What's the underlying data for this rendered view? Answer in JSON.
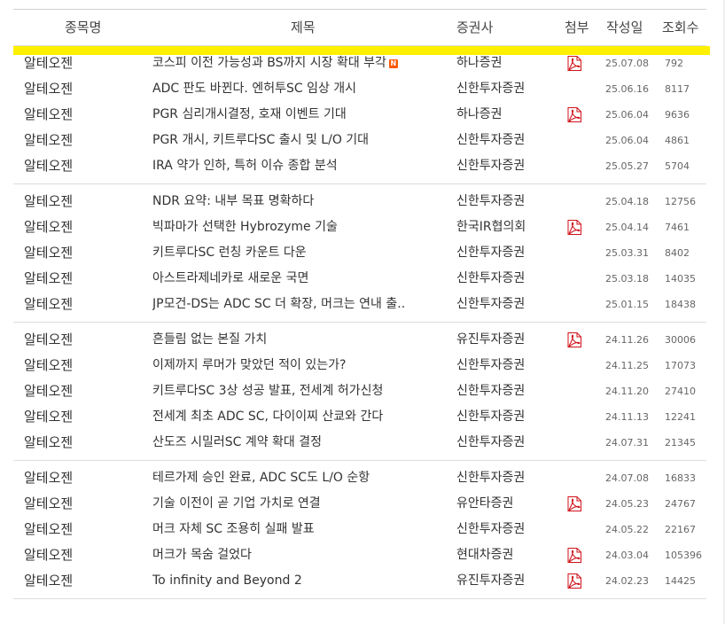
{
  "table": {
    "headers": {
      "stock": "종목명",
      "title": "제목",
      "broker": "증권사",
      "attach": "첨부",
      "date": "작성일",
      "views": "조회수"
    },
    "new_badge": "N",
    "groups": [
      [
        {
          "stock": "알테오젠",
          "title": "코스피 이전 가능성과 BS까지 시장 확대 부각",
          "is_new": true,
          "broker": "하나증권",
          "has_pdf": true,
          "date": "25.07.08",
          "views": "792"
        },
        {
          "stock": "알테오젠",
          "title": "ADC 판도 바뀐다. 엔허투SC 임상 개시",
          "is_new": false,
          "broker": "신한투자증권",
          "has_pdf": false,
          "date": "25.06.16",
          "views": "8117"
        },
        {
          "stock": "알테오젠",
          "title": "PGR 심리개시결정, 호재 이벤트 기대",
          "is_new": false,
          "broker": "하나증권",
          "has_pdf": true,
          "date": "25.06.04",
          "views": "9636"
        },
        {
          "stock": "알테오젠",
          "title": "PGR 개시, 키트루다SC 출시 및 L/O 기대",
          "is_new": false,
          "broker": "신한투자증권",
          "has_pdf": false,
          "date": "25.06.04",
          "views": "4861"
        },
        {
          "stock": "알테오젠",
          "title": "IRA 약가 인하, 특허 이슈 종합 분석",
          "is_new": false,
          "broker": "신한투자증권",
          "has_pdf": false,
          "date": "25.05.27",
          "views": "5704"
        }
      ],
      [
        {
          "stock": "알테오젠",
          "title": "NDR 요약: 내부 목표 명확하다",
          "is_new": false,
          "broker": "신한투자증권",
          "has_pdf": false,
          "date": "25.04.18",
          "views": "12756"
        },
        {
          "stock": "알테오젠",
          "title": "빅파마가 선택한 Hybrozyme 기술",
          "is_new": false,
          "broker": "한국IR협의회",
          "has_pdf": true,
          "date": "25.04.14",
          "views": "7461"
        },
        {
          "stock": "알테오젠",
          "title": "키트루다SC 런칭 카운트 다운",
          "is_new": false,
          "broker": "신한투자증권",
          "has_pdf": false,
          "date": "25.03.31",
          "views": "8402"
        },
        {
          "stock": "알테오젠",
          "title": "아스트라제네카로 새로운 국면",
          "is_new": false,
          "broker": "신한투자증권",
          "has_pdf": false,
          "date": "25.03.18",
          "views": "14035"
        },
        {
          "stock": "알테오젠",
          "title": "JP모건-DS는 ADC SC 더 확장, 머크는 연내 출..",
          "is_new": false,
          "broker": "신한투자증권",
          "has_pdf": false,
          "date": "25.01.15",
          "views": "18438"
        }
      ],
      [
        {
          "stock": "알테오젠",
          "title": "흔들림 없는 본질 가치",
          "is_new": false,
          "broker": "유진투자증권",
          "has_pdf": true,
          "date": "24.11.26",
          "views": "30006"
        },
        {
          "stock": "알테오젠",
          "title": "이제까지 루머가 맞았던 적이 있는가?",
          "is_new": false,
          "broker": "신한투자증권",
          "has_pdf": false,
          "date": "24.11.25",
          "views": "17073"
        },
        {
          "stock": "알테오젠",
          "title": "키트루다SC 3상 성공 발표, 전세계 허가신청",
          "is_new": false,
          "broker": "신한투자증권",
          "has_pdf": false,
          "date": "24.11.20",
          "views": "27410"
        },
        {
          "stock": "알테오젠",
          "title": "전세계 최초 ADC SC, 다이이찌 산쿄와 간다",
          "is_new": false,
          "broker": "신한투자증권",
          "has_pdf": false,
          "date": "24.11.13",
          "views": "12241"
        },
        {
          "stock": "알테오젠",
          "title": "산도즈 시밀러SC 계약 확대 결정",
          "is_new": false,
          "broker": "신한투자증권",
          "has_pdf": false,
          "date": "24.07.31",
          "views": "21345"
        }
      ],
      [
        {
          "stock": "알테오젠",
          "title": "테르가제 승인 완료, ADC SC도 L/O 순항",
          "is_new": false,
          "broker": "신한투자증권",
          "has_pdf": false,
          "date": "24.07.08",
          "views": "16833"
        },
        {
          "stock": "알테오젠",
          "title": "기술 이전이 곧 기업 가치로 연결",
          "is_new": false,
          "broker": "유안타증권",
          "has_pdf": true,
          "date": "24.05.23",
          "views": "24767"
        },
        {
          "stock": "알테오젠",
          "title": "머크 자체 SC 조용히 실패 발표",
          "is_new": false,
          "broker": "신한투자증권",
          "has_pdf": false,
          "date": "24.05.22",
          "views": "22167"
        },
        {
          "stock": "알테오젠",
          "title": "머크가 목숨 걸었다",
          "is_new": false,
          "broker": "현대차증권",
          "has_pdf": true,
          "date": "24.03.04",
          "views": "105396"
        },
        {
          "stock": "알테오젠",
          "title": "To infinity and Beyond 2",
          "is_new": false,
          "broker": "유진투자증권",
          "has_pdf": true,
          "date": "24.02.23",
          "views": "14425"
        }
      ]
    ]
  },
  "colors": {
    "highlight": "#fff000",
    "new_badge": "#ff5a00",
    "pdf_red": "#d0121b"
  },
  "icons": {
    "attachment": "pdf-file-icon"
  }
}
